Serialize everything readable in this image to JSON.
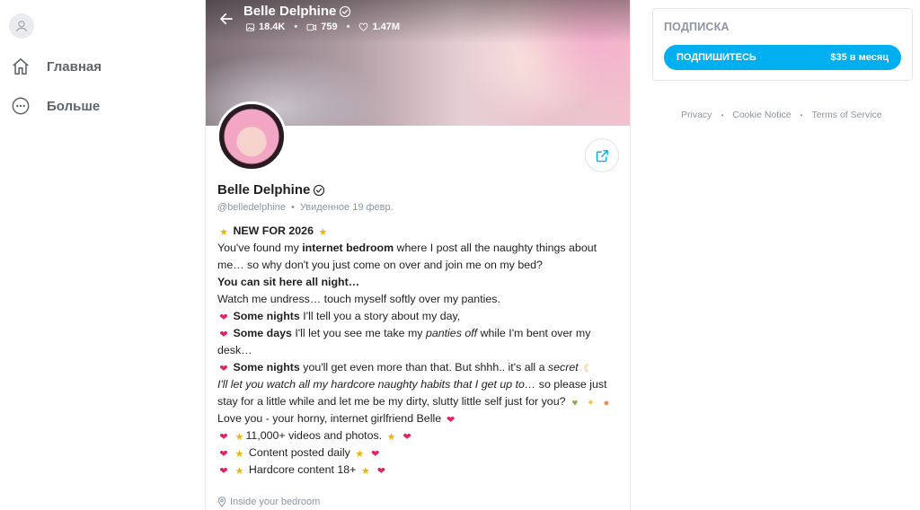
{
  "sidebar": {
    "items": [
      {
        "label": "Главная",
        "icon": "home-icon"
      },
      {
        "label": "Больше",
        "icon": "more-icon"
      }
    ]
  },
  "profile": {
    "name": "Belle Delphine",
    "handle": "@belledelphine",
    "seen": "Увиденное  19 февр.",
    "stats": {
      "photos": "18.4K",
      "videos": "759",
      "likes": "1.47M"
    },
    "bio": {
      "l1": "NEW FOR 2026",
      "l2a": "You've found my ",
      "l2b": "internet bedroom",
      "l2c": " where I post all the naughty things about me… so why don't you just come on over and join me on my bed?",
      "l3": "You can sit here all night…",
      "l4": "Watch me undress… touch myself softly over my panties.",
      "l5a": "Some nights",
      "l5b": " I'll tell you a story about my day,",
      "l6a": "Some days",
      "l6b": " I'll let you see me take my ",
      "l6c": "panties off",
      "l6d": " while I'm bent over my desk…",
      "l7a": "Some nights",
      "l7b": " you'll get even more than that. But shhh.. it's all a ",
      "l7c": "secret",
      "l8a": "I'll let you watch all my hardcore naughty habits that I get up to…",
      "l8b": " so please just stay for a little while and let me be my dirty, slutty little self just for you?",
      "l9": "Love you - your horny, internet girlfriend Belle",
      "l10": "11,000+ videos and photos.",
      "l11": "Content posted daily",
      "l12": "Hardcore content 18+"
    },
    "location": "Inside your bedroom"
  },
  "subscription": {
    "title": "ПОДПИСКА",
    "button_label": "ПОДПИШИТЕСЬ",
    "price": "$35 в месяц"
  },
  "footer": {
    "privacy": "Privacy",
    "cookie": "Cookie Notice",
    "terms": "Terms of Service"
  },
  "colors": {
    "accent": "#00aff0",
    "heart": "#e0245e",
    "muted": "#8a96a3"
  }
}
